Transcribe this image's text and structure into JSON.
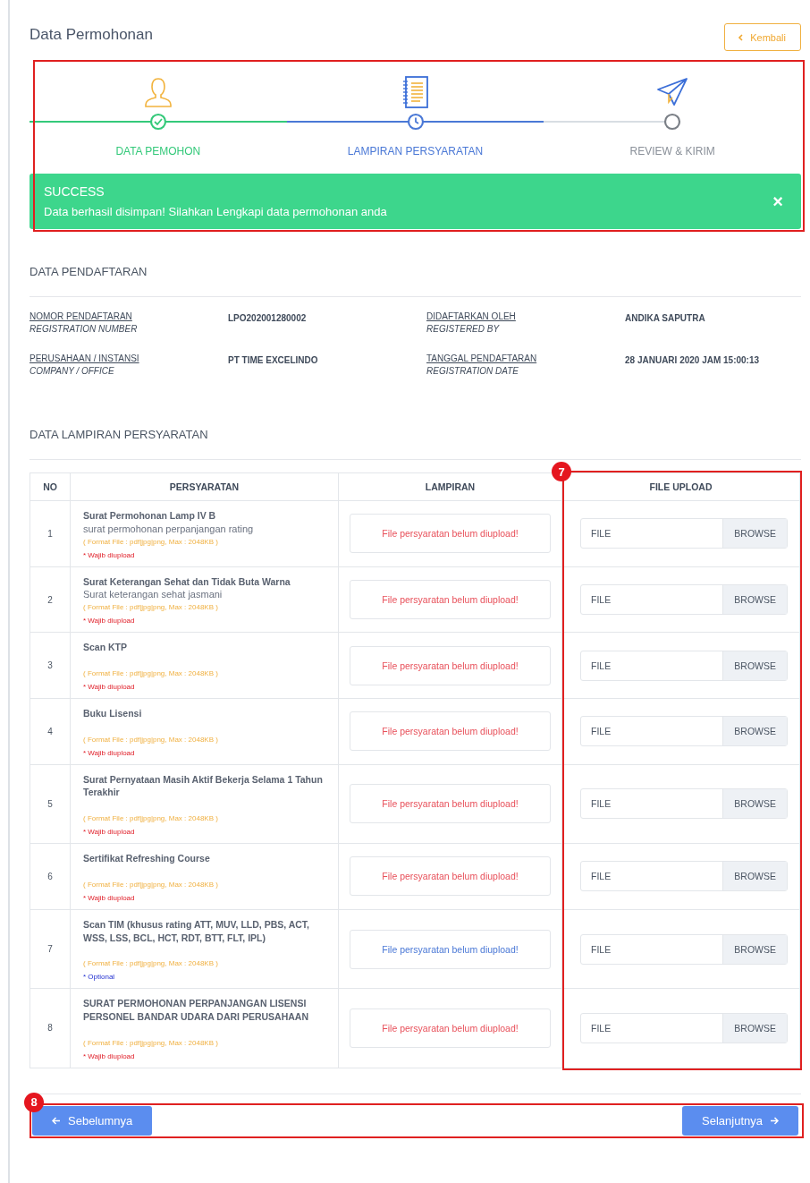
{
  "page": {
    "title": "Data Permohonan",
    "back_button": "Kembali"
  },
  "progress": {
    "highlighted": true,
    "steps": [
      {
        "label": "DATA PEMOHON",
        "completed": true,
        "current": false
      },
      {
        "label": "LAMPIRAN PERSYARATAN",
        "completed": false,
        "current": true
      },
      {
        "label": "REVIEW & KIRIM",
        "completed": false,
        "current": false
      }
    ]
  },
  "alert": {
    "title": "SUCCESS",
    "message": "Data berhasil disimpan! Silahkan Lengkapi data permohonan anda",
    "close": "×"
  },
  "registration": {
    "title": "DATA PENDAFTARAN",
    "fields": [
      {
        "label": "NOMOR PENDAFTARAN",
        "sublabel": "REGISTRATION NUMBER",
        "value": "LPO202001280002"
      },
      {
        "label": "DIDAFTARKAN OLEH",
        "sublabel": "REGISTERED BY",
        "value": "ANDIKA SAPUTRA"
      },
      {
        "label": "PERUSAHAAN / INSTANSI",
        "sublabel": "COMPANY / OFFICE",
        "value": "PT TIME EXCELINDO"
      },
      {
        "label": "TANGGAL PENDAFTARAN",
        "sublabel": "REGISTRATION DATE",
        "value": "28 JANUARI 2020 JAM 15:00:13"
      }
    ]
  },
  "attachments": {
    "title": "DATA LAMPIRAN PERSYARATAN",
    "columns": [
      "NO",
      "PERSYARATAN",
      "LAMPIRAN",
      "FILE UPLOAD"
    ],
    "upload_highlight_badge": "7",
    "rows": [
      {
        "no": "1",
        "name": "Surat Permohonan Lamp IV B",
        "description": "surat permohonan perpanjangan rating",
        "format": "( Format File : pdf|jpg|png, Max : 2048KB )",
        "note": "* Wajib diupload",
        "kind": "required",
        "status": "File persyaratan belum diupload!",
        "file_placeholder": "FILE",
        "browse": "BROWSE"
      },
      {
        "no": "2",
        "name": "Surat Keterangan Sehat dan Tidak Buta Warna",
        "description": "Surat keterangan sehat jasmani",
        "format": "( Format File : pdf|jpg|png, Max : 2048KB )",
        "note": "* Wajib diupload",
        "kind": "required",
        "status": "File persyaratan belum diupload!",
        "file_placeholder": "FILE",
        "browse": "BROWSE"
      },
      {
        "no": "3",
        "name": "Scan KTP",
        "format": "( Format File : pdf|jpg|png, Max : 2048KB )",
        "note": "* Wajib diupload",
        "kind": "required",
        "status": "File persyaratan belum diupload!",
        "file_placeholder": "FILE",
        "browse": "BROWSE"
      },
      {
        "no": "4",
        "name": "Buku Lisensi",
        "format": "( Format File : pdf|jpg|png, Max : 2048KB )",
        "note": "* Wajib diupload",
        "kind": "required",
        "status": "File persyaratan belum diupload!",
        "file_placeholder": "FILE",
        "browse": "BROWSE"
      },
      {
        "no": "5",
        "name": "Surat Pernyataan Masih Aktif Bekerja Selama 1 Tahun Terakhir",
        "format": "( Format File : pdf|jpg|png, Max : 2048KB )",
        "note": "* Wajib diupload",
        "kind": "required",
        "status": "File persyaratan belum diupload!",
        "file_placeholder": "FILE",
        "browse": "BROWSE"
      },
      {
        "no": "6",
        "name": "Sertifikat Refreshing Course",
        "format": "( Format File : pdf|jpg|png, Max : 2048KB )",
        "note": "* Wajib diupload",
        "kind": "required",
        "status": "File persyaratan belum diupload!",
        "file_placeholder": "FILE",
        "browse": "BROWSE"
      },
      {
        "no": "7",
        "name": "Scan TIM (khusus rating ATT, MUV, LLD, PBS, ACT, WSS, LSS, BCL, HCT, RDT, BTT, FLT, IPL)",
        "format": "( Format File : pdf|jpg|png, Max : 2048KB )",
        "note": "* Optional",
        "kind": "optional",
        "status": "File persyaratan belum diupload!",
        "file_placeholder": "FILE",
        "browse": "BROWSE"
      },
      {
        "no": "8",
        "name": "SURAT PERMOHONAN PERPANJANGAN LISENSI PERSONEL BANDAR UDARA DARI PERUSAHAAN",
        "format": "( Format File : pdf|jpg|png, Max : 2048KB )",
        "note": "* Wajib diupload",
        "kind": "required",
        "status": "File persyaratan belum diupload!",
        "file_placeholder": "FILE",
        "browse": "BROWSE"
      }
    ]
  },
  "footer": {
    "highlight_badge": "8",
    "previous": "Sebelumnya",
    "next": "Selanjutnya"
  }
}
